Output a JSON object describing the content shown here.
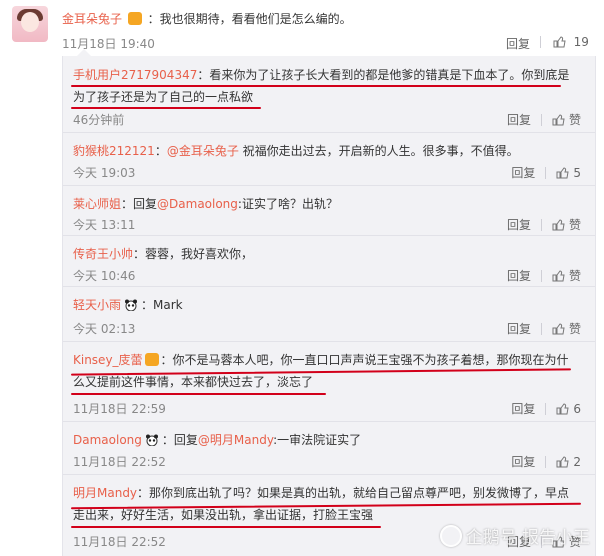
{
  "top_comment": {
    "user": "金耳朵兔子",
    "text": "：我也很期待，看看他们是怎么编的。",
    "time": "11月18日 19:40",
    "reply": "回复",
    "likes": "19"
  },
  "replies": [
    {
      "user": "手机用户2717904347",
      "text": "：看来你为了让孩子长大看到的都是他爹的错真是下血本了。你到底是为了孩子还是为了自己的一点私欲",
      "time": "46分钟前",
      "reply": "回复",
      "like": "赞"
    },
    {
      "user": "豹猴桃212121",
      "text_prefix": "：",
      "mention": "@金耳朵兔子",
      "text": " 祝福你走出过去，开启新的人生。很多事，不值得。",
      "time": "今天 19:03",
      "reply": "回复",
      "like": "5"
    },
    {
      "user": "莱心师姐",
      "text_prefix": "：回复",
      "mention": "@Damaolong",
      "text": ":证实了啥？出轨？",
      "time": "今天 13:11",
      "reply": "回复",
      "like": "赞"
    },
    {
      "user": "传奇王小帅",
      "text": "：蓉蓉，我好喜欢你，",
      "time": "今天 10:46",
      "reply": "回复",
      "like": "赞"
    },
    {
      "user": "轻天小雨",
      "text": "：Mark",
      "time": "今天 02:13",
      "reply": "回复",
      "like": "赞"
    },
    {
      "user": "Kinsey_庋蕾",
      "text": "：你不是马蓉本人吧，你一直口口声声说王宝强不为孩子着想，那你现在为什么又提前这件事情，本来都快过去了，淡忘了",
      "time": "11月18日 22:59",
      "reply": "回复",
      "like": "6"
    },
    {
      "user": "Damaolong",
      "text_prefix": "：回复",
      "mention": "@明月Mandy",
      "text": ":一审法院证实了",
      "time": "11月18日 22:52",
      "reply": "回复",
      "like": "2"
    },
    {
      "user": "明月Mandy",
      "text": "：那你到底出轨了吗？如果是真的出轨，就给自己留点尊严吧，别发微博了，早点走出来，好好生活，如果没出轨，拿出证据，打脸王宝强",
      "time": "11月18日 22:52",
      "reply": "回复",
      "like": "赞"
    }
  ],
  "watermark": "企鹅号 报告小王",
  "colors": {
    "username": "#e8604a",
    "underline": "#d2001a",
    "panel": "#f2f2f5"
  },
  "icons": {
    "like": "thumbs-up-icon",
    "vip": "vip-badge-icon",
    "emoji": "panda-emoji-icon",
    "watermark": "penguin-icon"
  }
}
